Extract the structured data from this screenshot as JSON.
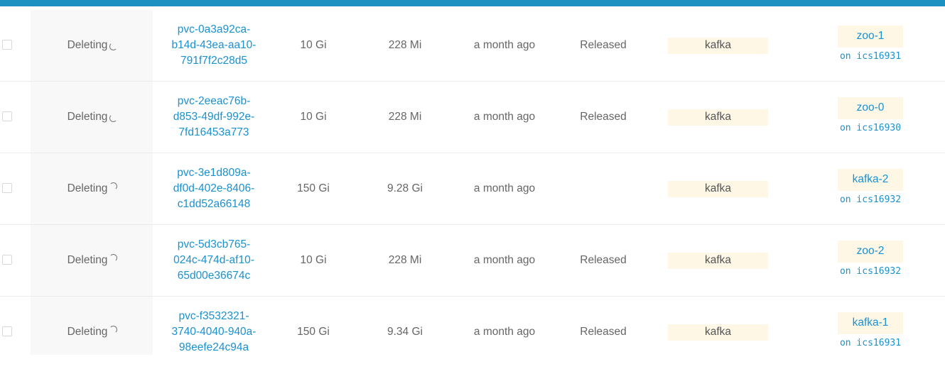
{
  "colors": {
    "accent": "#1a91c0",
    "link": "#1a91d0",
    "tag_bg": "#fef7e6"
  },
  "rows": [
    {
      "status": "Deleting",
      "spinner": "spinner-icon",
      "name_lines": [
        "pvc-0a3a92ca-",
        "b14d-43ea-aa10-",
        "791f7f2c28d5"
      ],
      "capacity": "10 Gi",
      "used": "228 Mi",
      "age": "a month ago",
      "phase": "Released",
      "storage_class": "kafka",
      "pod": "zoo-1",
      "node": "on ics16931"
    },
    {
      "status": "Deleting",
      "spinner": "spinner-icon",
      "name_lines": [
        "pvc-2eeac76b-",
        "d853-49df-992e-",
        "7fd16453a773"
      ],
      "capacity": "10 Gi",
      "used": "228 Mi",
      "age": "a month ago",
      "phase": "Released",
      "storage_class": "kafka",
      "pod": "zoo-0",
      "node": "on ics16930"
    },
    {
      "status": "Deleting",
      "spinner": "spinner-icon",
      "name_lines": [
        "pvc-3e1d809a-",
        "df0d-402e-8406-",
        "c1dd52a66148"
      ],
      "capacity": "150 Gi",
      "used": "9.28 Gi",
      "age": "a month ago",
      "phase": "",
      "storage_class": "kafka",
      "pod": "kafka-2",
      "node": "on ics16932"
    },
    {
      "status": "Deleting",
      "spinner": "spinner-icon",
      "name_lines": [
        "pvc-5d3cb765-",
        "024c-474d-af10-",
        "65d00e36674c"
      ],
      "capacity": "10 Gi",
      "used": "228 Mi",
      "age": "a month ago",
      "phase": "Released",
      "storage_class": "kafka",
      "pod": "zoo-2",
      "node": "on ics16932"
    },
    {
      "status": "Deleting",
      "spinner": "spinner-icon",
      "name_lines": [
        "pvc-f3532321-",
        "3740-4040-940a-",
        "98eefe24c94a"
      ],
      "capacity": "150 Gi",
      "used": "9.34 Gi",
      "age": "a month ago",
      "phase": "Released",
      "storage_class": "kafka",
      "pod": "kafka-1",
      "node": "on ics16931"
    }
  ]
}
